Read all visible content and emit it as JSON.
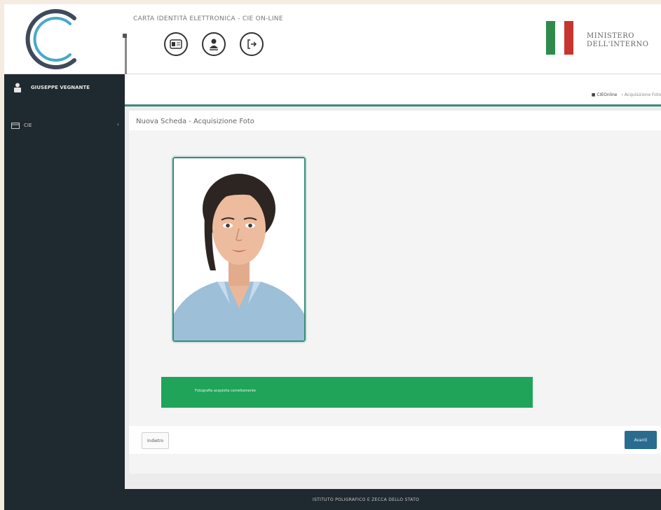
{
  "header": {
    "app_title": "CARTA IDENTITÀ ELETTRONICA - CIE ON-LINE",
    "ministry_line1": "MINISTERO",
    "ministry_line2": "DELL'INTERNO",
    "flag_colors": [
      "#2e8b4c",
      "#ffffff",
      "#c8352f"
    ],
    "icons": [
      "id-card-icon",
      "user-download-icon",
      "logout-icon"
    ]
  },
  "sidebar": {
    "user_name": "GIUSEPPE VEGNANTE",
    "items": [
      {
        "label": "CIE",
        "icon": "card-icon"
      }
    ]
  },
  "breadcrumb": {
    "home": "CIEOnline",
    "current": "Acquisizione Foto"
  },
  "panel": {
    "title": "Nuova Scheda - Acquisizione Foto"
  },
  "alert": {
    "message": "Fotografia acquisita correttamente",
    "color": "#1fa45a"
  },
  "actions": {
    "back_label": "Indietro",
    "next_label": "Avanti",
    "next_color": "#2a6c8f"
  },
  "footer": {
    "text": "ISTITUTO POLIGRAFICO E ZECCA DELLO STATO"
  },
  "colors": {
    "accent": "#3a8a7a",
    "sidebar_bg": "#1f2a30"
  }
}
